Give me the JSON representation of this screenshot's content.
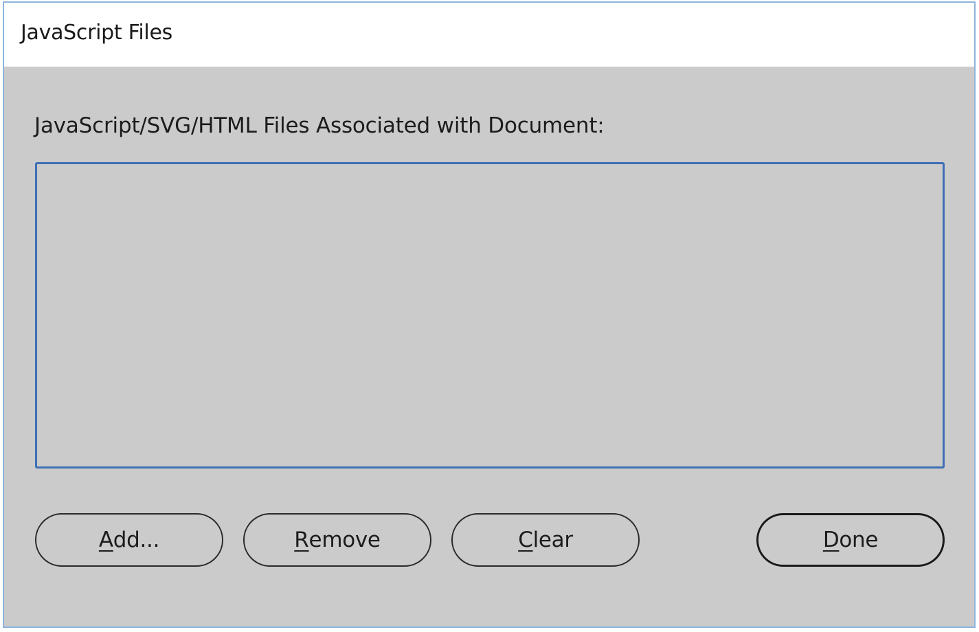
{
  "window": {
    "title": "JavaScript Files",
    "colors": {
      "titlebar": "#ffffff",
      "body": "#cbcbcb",
      "frame": "#8cb4dc",
      "list_focus_border": "#3e6fb6"
    }
  },
  "main": {
    "files_label": "JavaScript/SVG/HTML Files Associated with Document:",
    "files": []
  },
  "buttons": {
    "add": {
      "mnemonic": "A",
      "rest": "dd..."
    },
    "remove": {
      "mnemonic": "R",
      "rest": "emove"
    },
    "clear": {
      "mnemonic": "C",
      "rest": "lear"
    },
    "done": {
      "mnemonic": "D",
      "rest": "one"
    }
  }
}
